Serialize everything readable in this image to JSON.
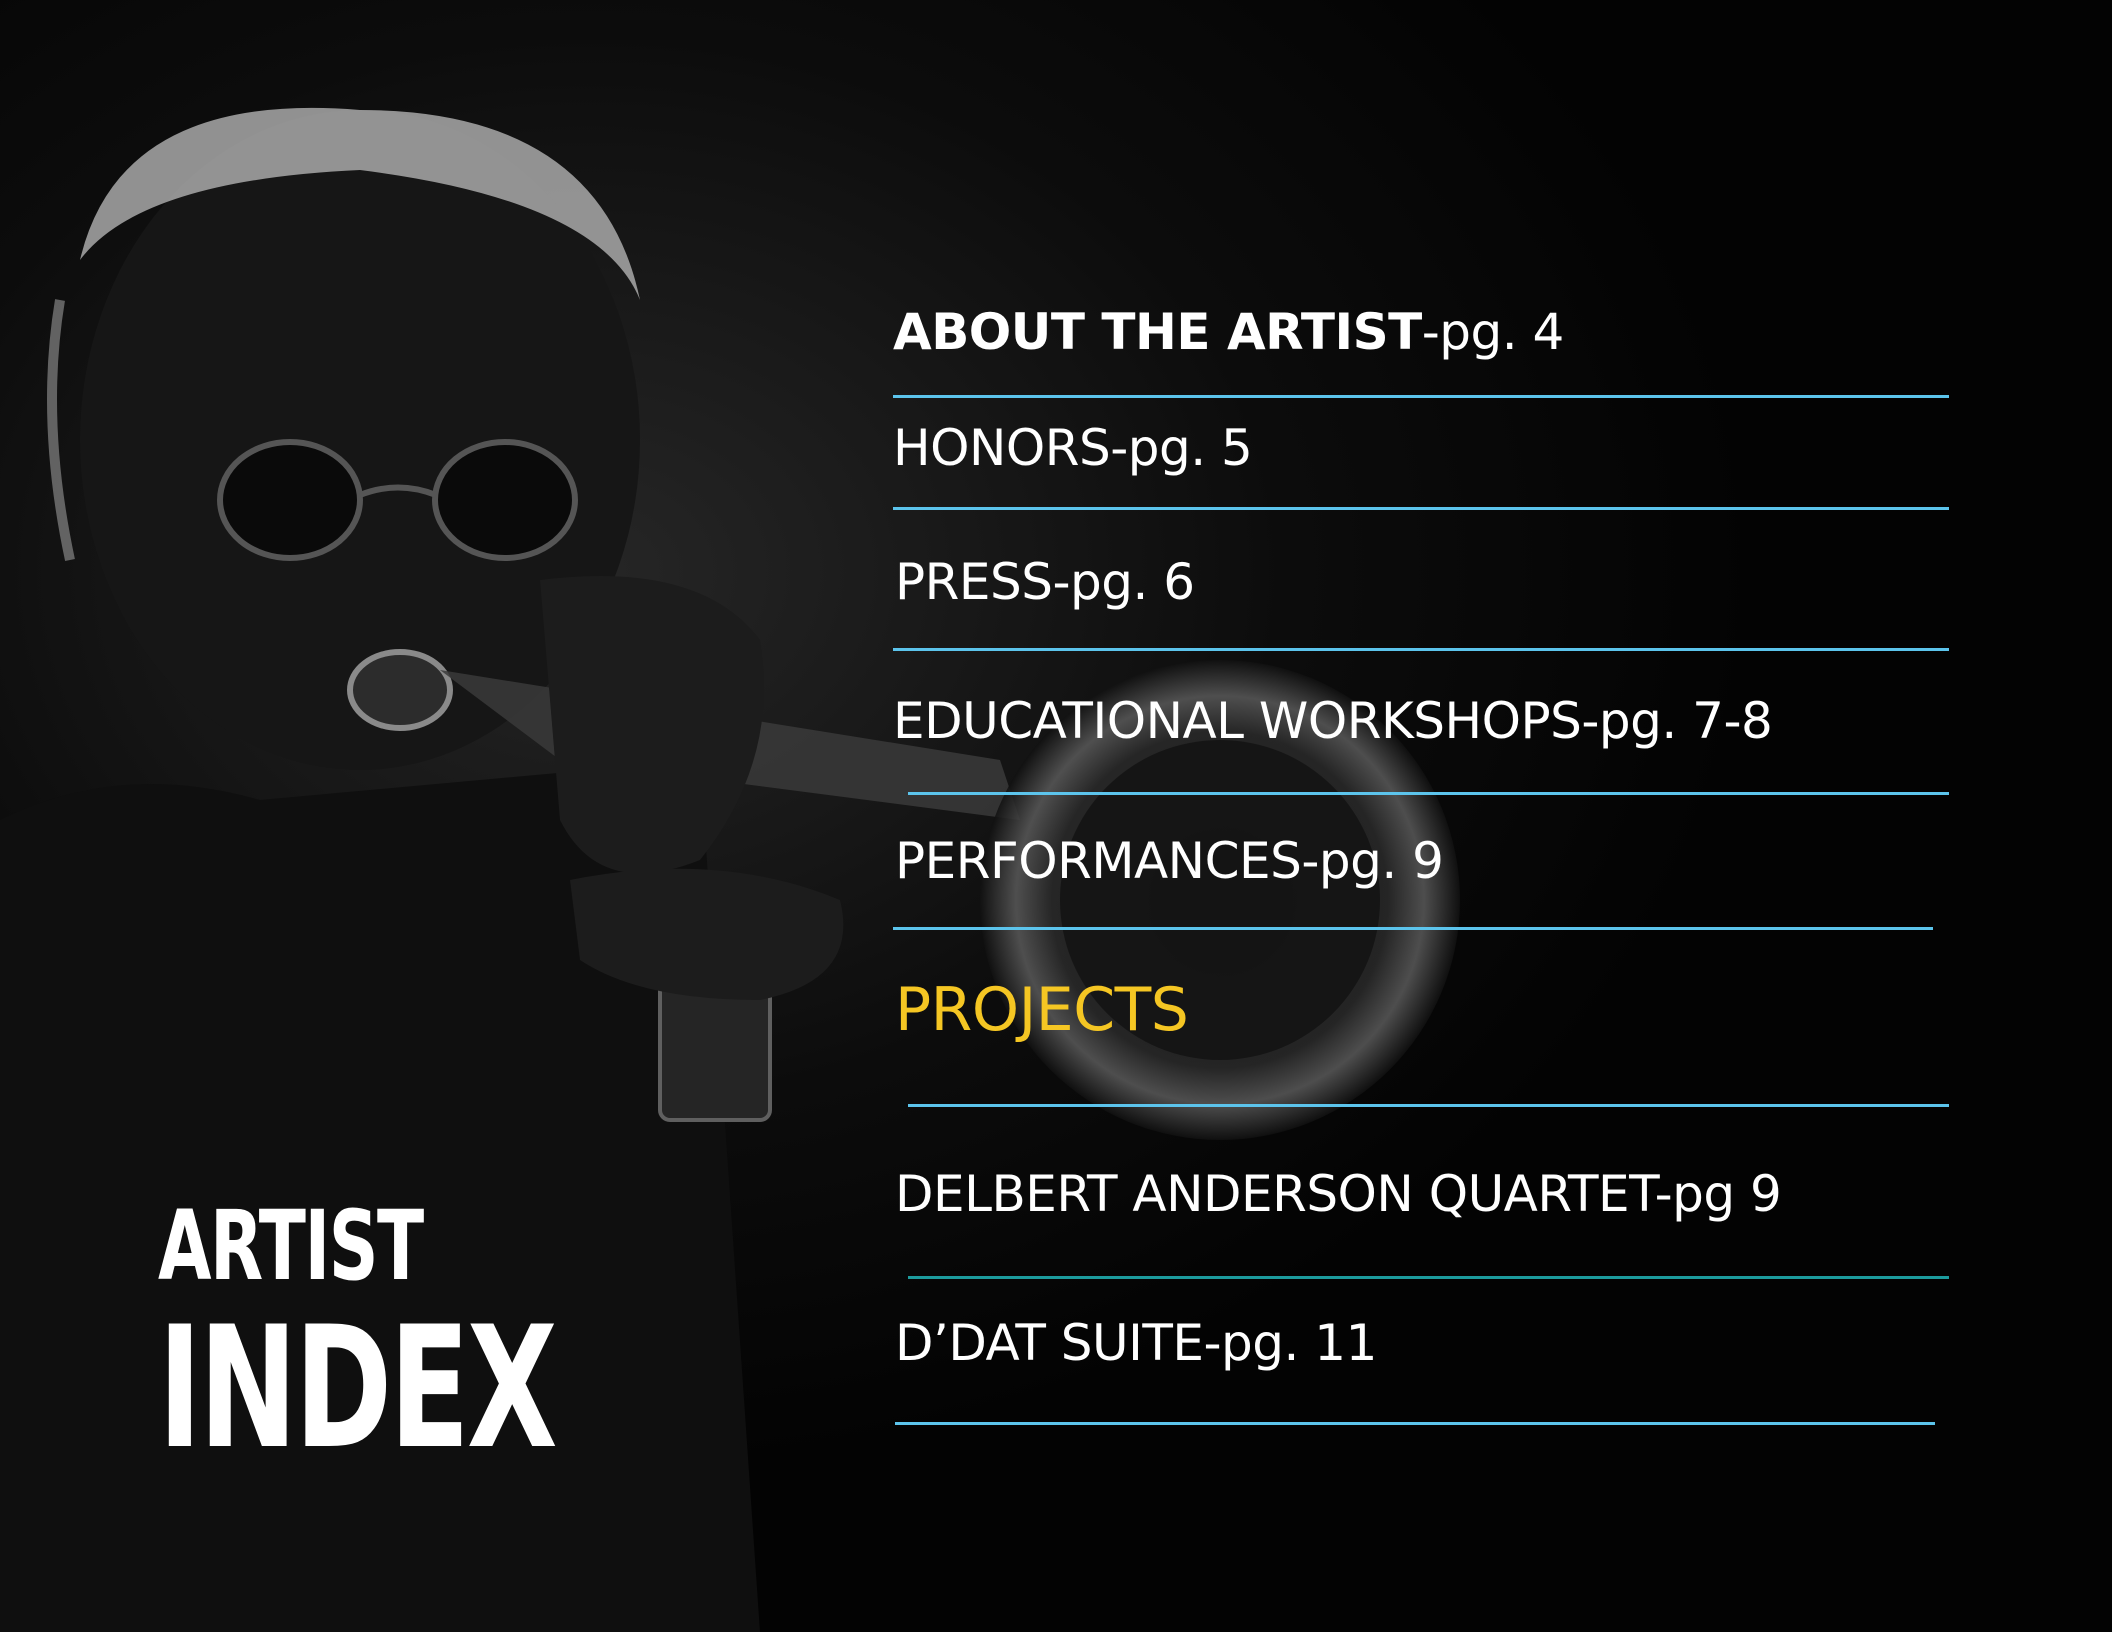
{
  "title": {
    "line1": "ARTIST",
    "line2": "INDEX"
  },
  "entries": [
    {
      "lead": "ABOUT THE ARTIST",
      "suffix": "-pg. 4"
    },
    {
      "lead": "HONORS",
      "suffix": "-pg. 5"
    },
    {
      "lead": "PRESS",
      "suffix": "-pg. 6"
    },
    {
      "lead": "EDUCATIONAL WORKSHOPS",
      "suffix": "-pg. 7-8"
    },
    {
      "lead": "PERFORMANCES",
      "suffix": "-pg. 9"
    }
  ],
  "projects_heading": "PROJECTS",
  "projects": [
    {
      "lead": "DELBERT ANDERSON QUARTET",
      "suffix": "-pg 9"
    },
    {
      "lead": "D’DAT SUITE",
      "suffix": "-pg. 11"
    }
  ],
  "colors": {
    "background": "#050505",
    "text": "#ffffff",
    "rule": "#5cc4ec",
    "rule_teal": "#1c9b9d",
    "section_heading": "#f5c623"
  }
}
